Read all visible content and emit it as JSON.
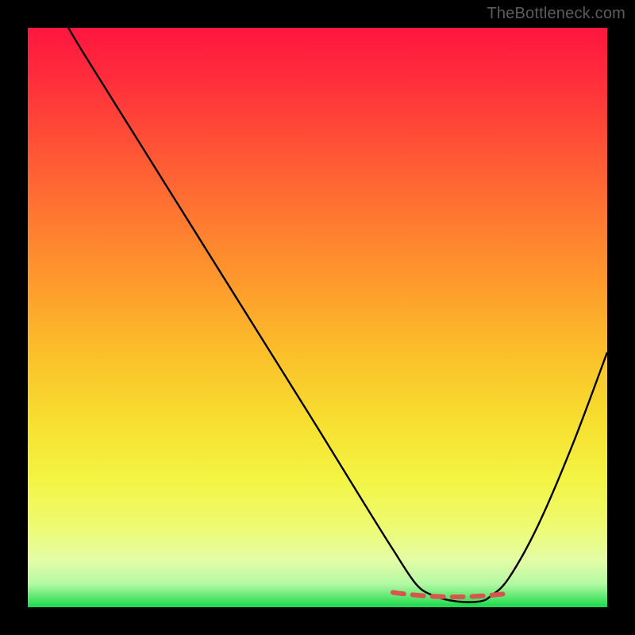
{
  "attribution": "TheBottleneck.com",
  "colors": {
    "frame": "#000000",
    "curve": "#000000",
    "marker": "#d9534f",
    "gradient_top": "#ff163f",
    "gradient_bottom": "#19d94e"
  },
  "chart_data": {
    "type": "line",
    "title": "",
    "xlabel": "",
    "ylabel": "",
    "xlim": [
      0,
      100
    ],
    "ylim": [
      0,
      100
    ],
    "note": "Axes implied by plot area; values estimated as percentage of plot width/height. The curve descends from top-left, reaches a flat minimum near x=68–80, then rises toward the right edge.",
    "series": [
      {
        "name": "bottleneck-curve",
        "x": [
          7,
          10,
          20,
          30,
          40,
          50,
          58,
          63,
          67,
          70,
          74,
          78,
          80,
          83,
          88,
          94,
          100
        ],
        "values": [
          100,
          95,
          79,
          63,
          47,
          31,
          18,
          10,
          4,
          2,
          1,
          1,
          2,
          5,
          14,
          28,
          44
        ]
      }
    ],
    "annotations": [
      {
        "name": "optimal-range-marker",
        "shape": "dashed-segment",
        "x_start": 63,
        "x_end": 82,
        "y": 2
      }
    ]
  }
}
